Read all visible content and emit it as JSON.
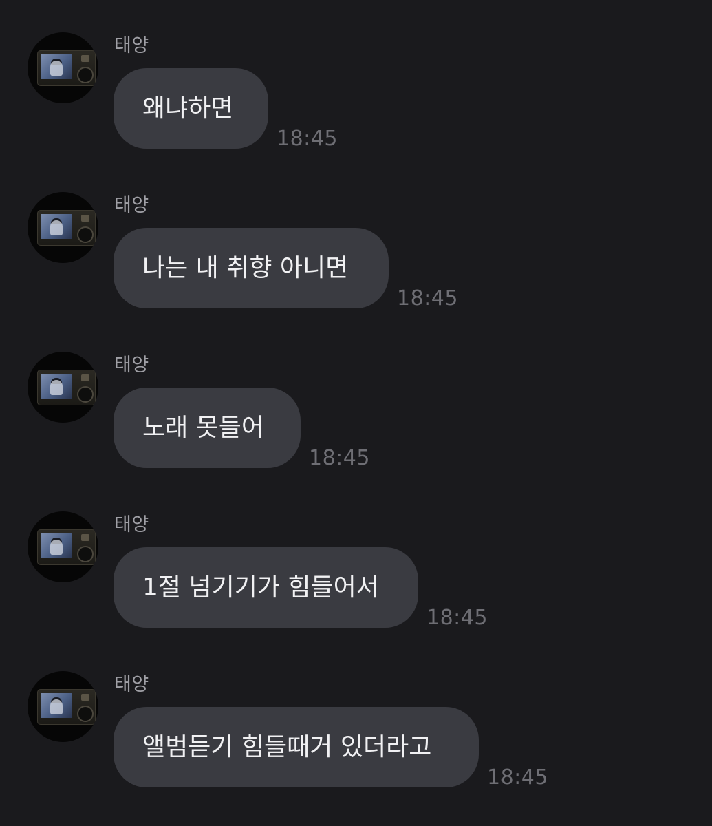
{
  "messages": [
    {
      "sender": "태양",
      "text": "왜냐하면",
      "time": "18:45"
    },
    {
      "sender": "태양",
      "text": "나는 내 취향 아니면",
      "time": "18:45"
    },
    {
      "sender": "태양",
      "text": "노래 못들어",
      "time": "18:45"
    },
    {
      "sender": "태양",
      "text": "1절 넘기기가 힘들어서",
      "time": "18:45"
    },
    {
      "sender": "태양",
      "text": "앨범듣기 힘들때거 있더라고",
      "time": "18:45"
    }
  ]
}
